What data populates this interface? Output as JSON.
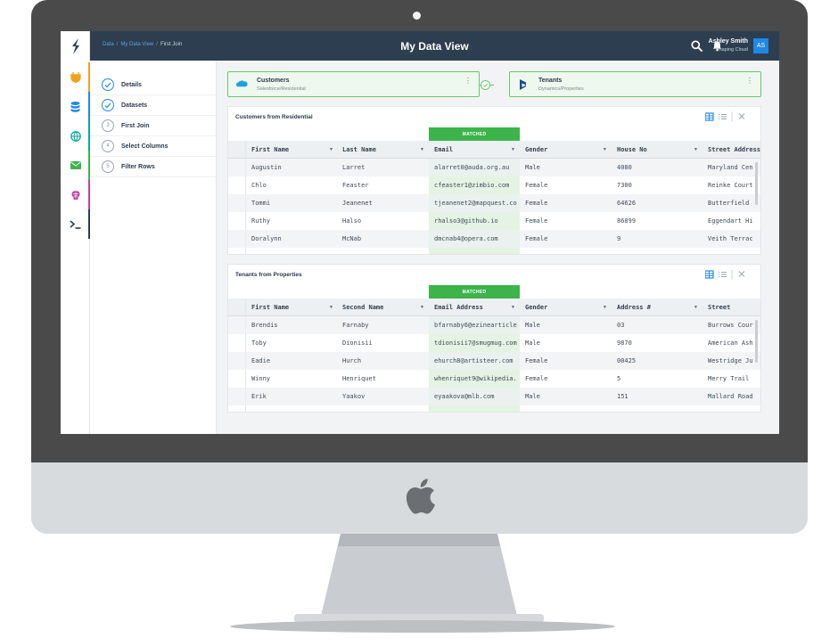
{
  "app": {
    "breadcrumbs": [
      "Data",
      "My Data View",
      "First Join"
    ],
    "title": "My Data View",
    "user": {
      "name": "Ashley Smith",
      "org": "Shaping Cloud",
      "initials": "AS"
    }
  },
  "rail": {
    "items": [
      {
        "icon": "plug-icon",
        "color": "#f0a21e"
      },
      {
        "icon": "database-icon",
        "color": "#1e88e5"
      },
      {
        "icon": "globe-icon",
        "color": "#0aa5a0"
      },
      {
        "icon": "mail-icon",
        "color": "#3cb44b"
      },
      {
        "icon": "brain-icon",
        "color": "#c13fa8"
      },
      {
        "icon": "terminal-icon",
        "color": "#2d3e50"
      }
    ]
  },
  "steps": [
    {
      "label": "Details",
      "state": "done"
    },
    {
      "label": "Datasets",
      "state": "done"
    },
    {
      "label": "First Join",
      "number": "3",
      "state": "current"
    },
    {
      "label": "Select Columns",
      "number": "4",
      "state": "pending"
    },
    {
      "label": "Filter Rows",
      "number": "5",
      "state": "pending"
    }
  ],
  "sources": {
    "left": {
      "title": "Customers",
      "sub": "Salesforce/Residential",
      "icon": "salesforce-icon"
    },
    "right": {
      "title": "Tenants",
      "sub": "Dynamics/Properties",
      "icon": "dynamics-icon"
    }
  },
  "customers": {
    "title": "Customers from Residential",
    "matched_label": "MATCHED",
    "columns": [
      "First Name",
      "Last Name",
      "Email",
      "Gender",
      "House No",
      "Street Address"
    ],
    "rows": [
      [
        "Augustin",
        "Larret",
        "alarret0@auda.org.au",
        "Male",
        "4080",
        "Maryland Cen"
      ],
      [
        "Chlo",
        "Feaster",
        "cfeaster1@zimbio.com",
        "Female",
        "7300",
        "Reinke Court"
      ],
      [
        "Tommi",
        "Jeanenet",
        "tjeanenet2@mapquest.co",
        "Female",
        "64626",
        "Butterfield"
      ],
      [
        "Ruthy",
        "Halso",
        "rhalso3@github.io",
        "Female",
        "86899",
        "Eggendart Hi"
      ],
      [
        "Doralynn",
        "McNab",
        "dmcnab4@opera.com",
        "Female",
        "9",
        "Veith Terrac"
      ]
    ]
  },
  "tenants": {
    "title": "Tenants from Properties",
    "matched_label": "MATCHED",
    "columns": [
      "First Name",
      "Second Name",
      "Email Address",
      "Gender",
      "Address #",
      "Street"
    ],
    "rows": [
      [
        "Brendis",
        "Farnaby",
        "bfarnaby6@ezinearticle",
        "Male",
        "03",
        "Burrows Cour"
      ],
      [
        "Toby",
        "Dionisii",
        "tdionisii7@smugmug.com",
        "Male",
        "9870",
        "American Ash"
      ],
      [
        "Eadie",
        "Hurch",
        "ehurch8@artisteer.com",
        "Female",
        "00425",
        "Westridge Ju"
      ],
      [
        "Winny",
        "Henriquet",
        "whenriquet9@wikipedia.",
        "Female",
        "5",
        "Merry Trail"
      ],
      [
        "Erik",
        "Yaakov",
        "eyaakova@mlb.com",
        "Male",
        "151",
        "Mallard Road"
      ]
    ]
  }
}
